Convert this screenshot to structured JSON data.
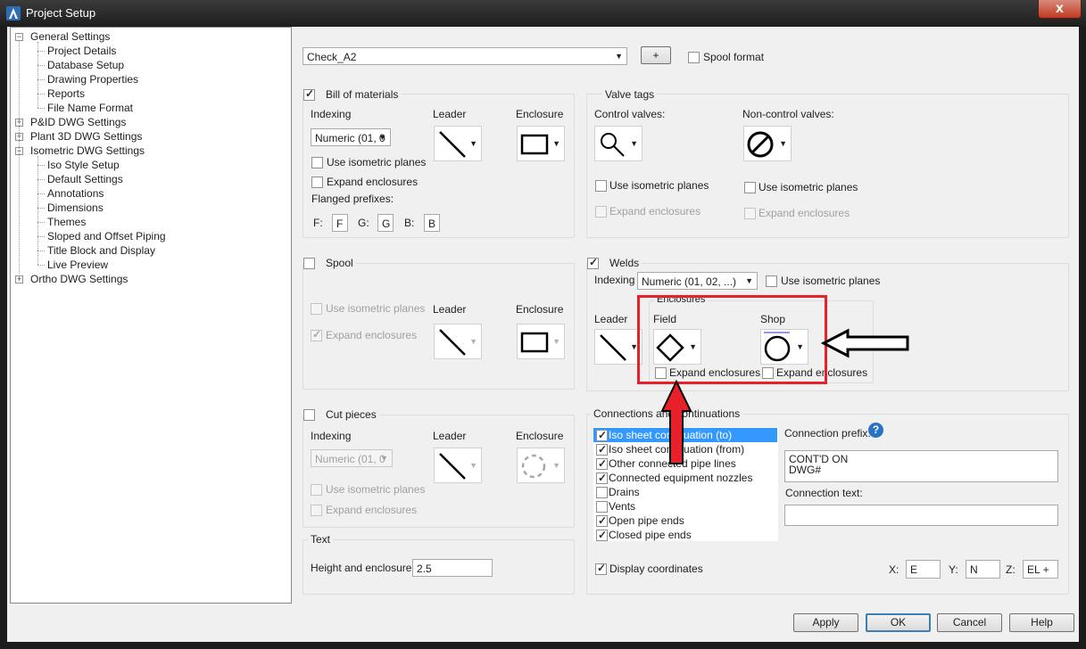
{
  "window": {
    "title": "Project Setup",
    "close_glyph": "x"
  },
  "tree": [
    {
      "label": "General Settings",
      "expander": "−"
    },
    {
      "label": "Project Details"
    },
    {
      "label": "Database Setup"
    },
    {
      "label": "Drawing Properties"
    },
    {
      "label": "Reports"
    },
    {
      "label": "File Name Format"
    },
    {
      "label": "P&ID DWG Settings",
      "expander": "+"
    },
    {
      "label": "Plant 3D DWG Settings",
      "expander": "+"
    },
    {
      "label": "Isometric DWG Settings",
      "expander": "−"
    },
    {
      "label": "Iso Style Setup"
    },
    {
      "label": "Default Settings"
    },
    {
      "label": "Annotations"
    },
    {
      "label": "Dimensions"
    },
    {
      "label": "Themes"
    },
    {
      "label": "Sloped and Offset Piping"
    },
    {
      "label": "Title Block and Display"
    },
    {
      "label": "Live Preview"
    },
    {
      "label": "Ortho DWG Settings",
      "expander": "+"
    }
  ],
  "top": {
    "style_combo": "Check_A2",
    "add_button": "+",
    "spool_format": "Spool format"
  },
  "bom": {
    "title": "Bill of materials",
    "indexing": "Indexing",
    "leader": "Leader",
    "enclosure": "Enclosure",
    "index_combo": "Numeric (01, 0",
    "use_iso": "Use isometric planes",
    "expand": "Expand enclosures",
    "flanged": "Flanged prefixes:",
    "f_label": "F:",
    "f_val": "F",
    "g_label": "G:",
    "g_val": "G",
    "b_label": "B:",
    "b_val": "B"
  },
  "valve": {
    "title": "Valve tags",
    "control": "Control valves:",
    "noncontrol": "Non-control valves:",
    "use_iso": "Use isometric planes",
    "expand": "Expand enclosures"
  },
  "spool": {
    "title": "Spool",
    "use_iso": "Use isometric planes",
    "expand": "Expand enclosures",
    "leader": "Leader",
    "enclosure": "Enclosure"
  },
  "welds": {
    "title": "Welds",
    "indexing": "Indexing",
    "index_combo": "Numeric (01, 02, ...)",
    "use_iso": "Use isometric planes",
    "enclosures": "Enclosures",
    "leader": "Leader",
    "field": "Field",
    "shop": "Shop",
    "expand": "Expand enclosures"
  },
  "cut": {
    "title": "Cut pieces",
    "indexing": "Indexing",
    "leader": "Leader",
    "enclosure": "Enclosure",
    "index_combo": "Numeric (01, 0",
    "use_iso": "Use isometric planes",
    "expand": "Expand enclosures"
  },
  "text": {
    "title": "Text",
    "height_label": "Height and enclosure:",
    "height_val": "2.5"
  },
  "conn": {
    "title": "Connections and continuations",
    "items": [
      {
        "label": "Iso sheet continuation (to)",
        "checked": true,
        "selected": true
      },
      {
        "label": "Iso sheet continuation (from)",
        "checked": true
      },
      {
        "label": "Other connected pipe lines",
        "checked": true
      },
      {
        "label": "Connected equipment nozzles",
        "checked": true
      },
      {
        "label": "Drains",
        "checked": false
      },
      {
        "label": "Vents",
        "checked": false
      },
      {
        "label": "Open pipe ends",
        "checked": true
      },
      {
        "label": "Closed pipe ends",
        "checked": true
      }
    ],
    "prefix_label": "Connection prefix:",
    "prefix_val": "CONT'D ON\nDWG#",
    "text_label": "Connection text:",
    "text_val": "",
    "display_coords": "Display coordinates",
    "x_label": "X:",
    "x_val": "E",
    "y_label": "Y:",
    "y_val": "N",
    "z_label": "Z:",
    "z_val": "EL +"
  },
  "buttons": {
    "apply": "Apply",
    "ok": "OK",
    "cancel": "Cancel",
    "help": "Help"
  },
  "help_glyph": "?",
  "annotation_colors": {
    "box": "#e8202a",
    "red_arrow": "#e8202a",
    "black_arrow": "#000000"
  }
}
